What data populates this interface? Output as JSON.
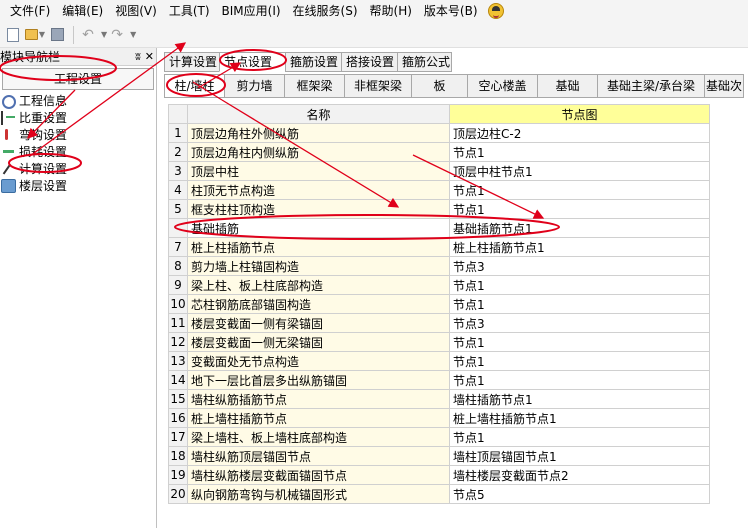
{
  "menu": [
    "文件(F)",
    "编辑(E)",
    "视图(V)",
    "工具(T)",
    "BIM应用(I)",
    "在线服务(S)",
    "帮助(H)",
    "版本号(B)"
  ],
  "left_panel": {
    "title": "模块导航栏",
    "pin": "ʬ",
    "close": "✕",
    "tab": "工程设置",
    "items": [
      "工程信息",
      "比重设置",
      "弯钩设置",
      "损耗设置",
      "计算设置",
      "楼层设置"
    ]
  },
  "outer_tabs": [
    "计算设置",
    "节点设置",
    "箍筋设置",
    "搭接设置",
    "箍筋公式"
  ],
  "inner_tabs": [
    "柱/墙柱",
    "剪力墙",
    "框架梁",
    "非框架梁",
    "板",
    "空心楼盖",
    "基础",
    "基础主梁/承台梁",
    "基础次"
  ],
  "grid": {
    "headers": [
      "名称",
      "节点图"
    ],
    "rows": [
      {
        "no": "1",
        "name": "顶层边角柱外侧纵筋",
        "node": "顶层边柱C-2"
      },
      {
        "no": "2",
        "name": "顶层边角柱内侧纵筋",
        "node": "节点1"
      },
      {
        "no": "3",
        "name": "顶层中柱",
        "node": "顶层中柱节点1"
      },
      {
        "no": "4",
        "name": "柱顶无节点构造",
        "node": "节点1"
      },
      {
        "no": "5",
        "name": "框支柱柱顶构造",
        "node": "节点1"
      },
      {
        "no": "",
        "name": "基础插筋",
        "node": "基础插筋节点1"
      },
      {
        "no": "7",
        "name": "桩上柱插筋节点",
        "node": "桩上柱插筋节点1"
      },
      {
        "no": "8",
        "name": "剪力墙上柱锚固构造",
        "node": "节点3"
      },
      {
        "no": "9",
        "name": "梁上柱、板上柱底部构造",
        "node": "节点1"
      },
      {
        "no": "10",
        "name": "芯柱钢筋底部锚固构造",
        "node": "节点1"
      },
      {
        "no": "11",
        "name": "楼层变截面一侧有梁锚固",
        "node": "节点3"
      },
      {
        "no": "12",
        "name": "楼层变截面一侧无梁锚固",
        "node": "节点1"
      },
      {
        "no": "13",
        "name": "变截面处无节点构造",
        "node": "节点1"
      },
      {
        "no": "14",
        "name": "地下一层比首层多出纵筋锚固",
        "node": "节点1"
      },
      {
        "no": "15",
        "name": "墙柱纵筋插筋节点",
        "node": "墙柱插筋节点1"
      },
      {
        "no": "16",
        "name": "桩上墙柱插筋节点",
        "node": "桩上墙柱插筋节点1"
      },
      {
        "no": "17",
        "name": "梁上墙柱、板上墙柱底部构造",
        "node": "节点1"
      },
      {
        "no": "18",
        "name": "墙柱纵筋顶层锚固节点",
        "node": "墙柱顶层锚固节点1"
      },
      {
        "no": "19",
        "name": "墙柱纵筋楼层变截面锚固节点",
        "node": "墙柱楼层变截面节点2"
      },
      {
        "no": "20",
        "name": "纵向钢筋弯钩与机械锚固形式",
        "node": "节点5"
      }
    ]
  },
  "colors": {
    "annotation": "#e0001a",
    "node_header": "#ffff99",
    "name_column": "#fffbe6"
  }
}
